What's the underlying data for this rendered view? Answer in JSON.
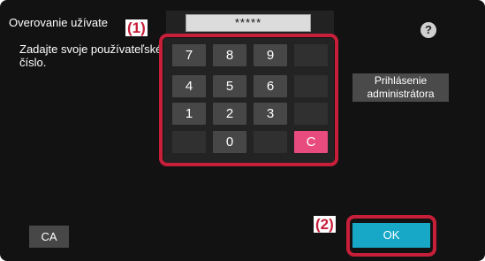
{
  "dialog": {
    "title": "Overovanie užívate",
    "prompt": "Zadajte svoje používateľské číslo.",
    "help_label": "?"
  },
  "pin_field": {
    "value": "*****"
  },
  "keypad": {
    "keys": [
      "7",
      "8",
      "9",
      "4",
      "5",
      "6",
      "1",
      "2",
      "3",
      "0",
      "C"
    ]
  },
  "buttons": {
    "admin_login": "Prihlásenie administrátora",
    "ca": "CA",
    "ok": "OK"
  },
  "callouts": {
    "keypad": "(1)",
    "ok": "(2)"
  },
  "colors": {
    "screen_bg": "#121212",
    "key_bg": "#474747",
    "clear_key": "#e84b7d",
    "ok_button": "#17a8c8",
    "callout": "#c71f3a"
  }
}
